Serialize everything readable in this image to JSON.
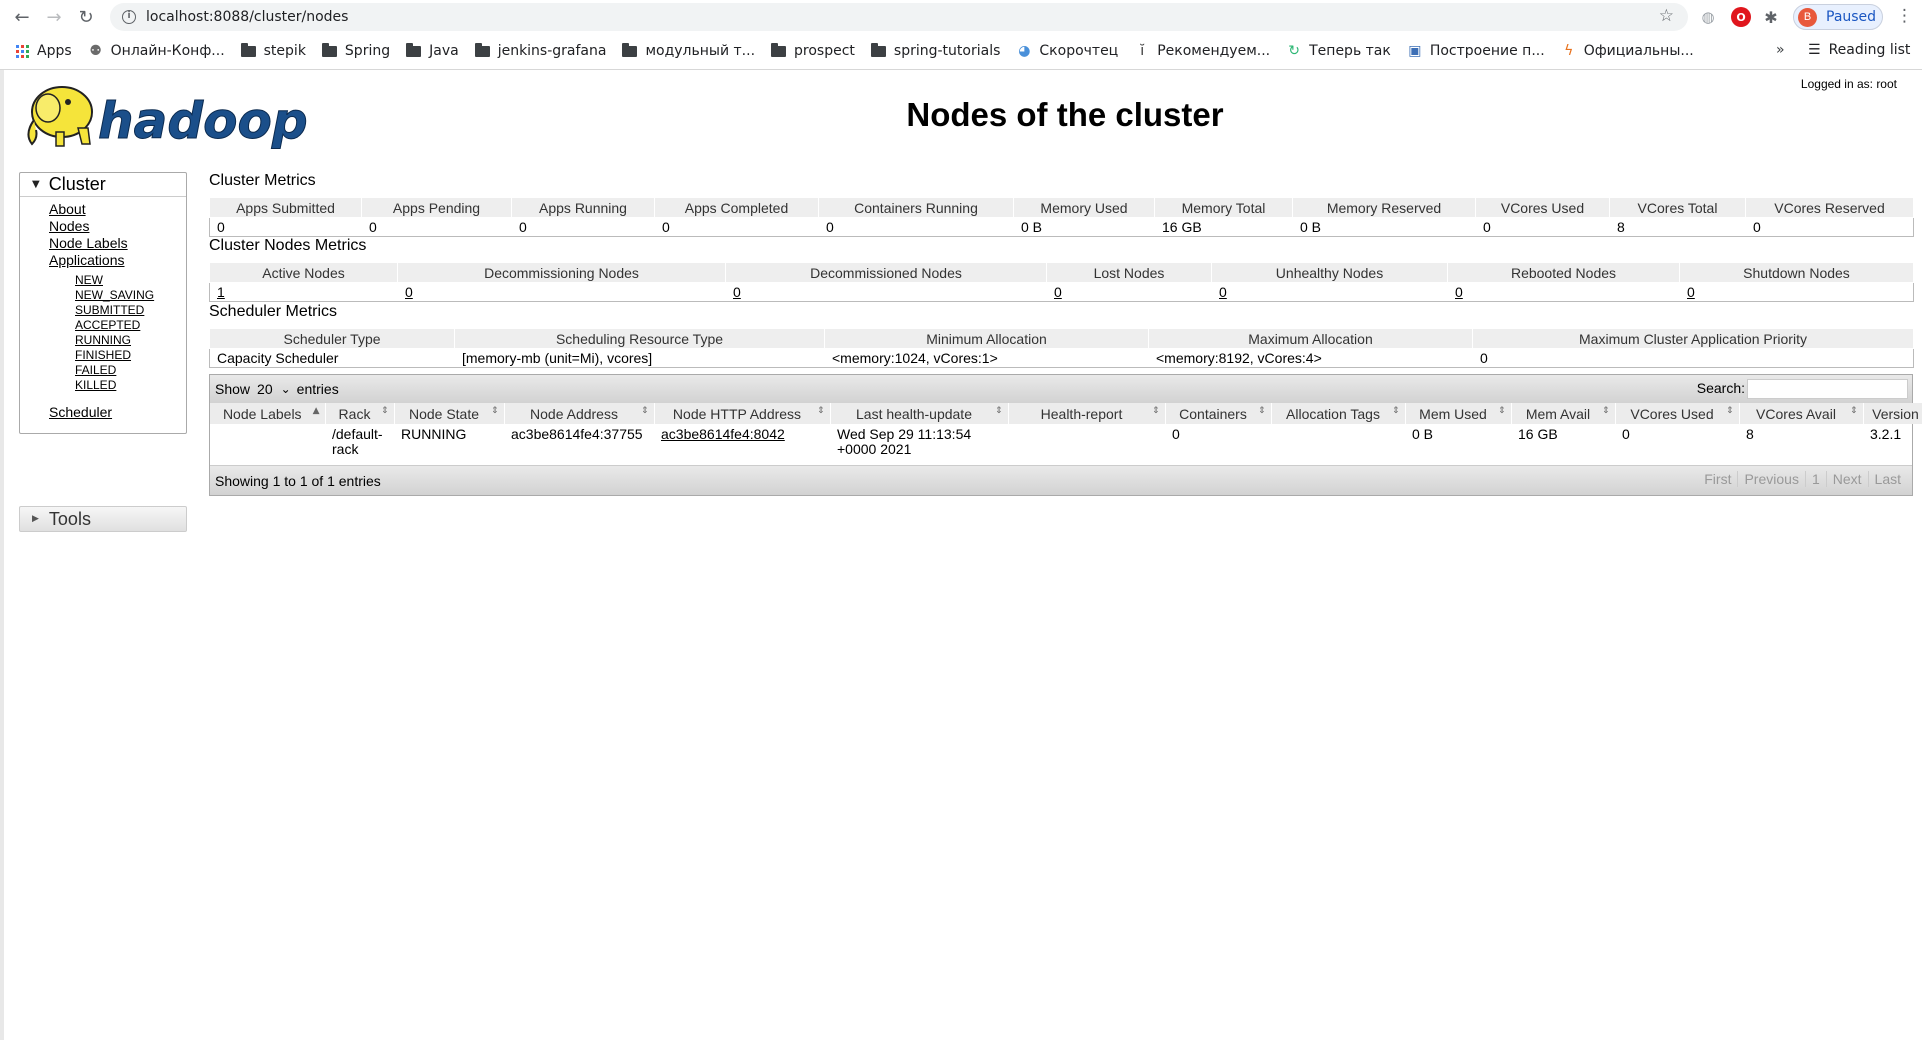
{
  "browser": {
    "url": "localhost:8088/cluster/nodes",
    "profile": {
      "initial": "B",
      "status": "Paused"
    },
    "bookmarks": [
      {
        "label": "Apps",
        "icon": "apps-grid-icon"
      },
      {
        "label": "Онлайн-Конф...",
        "icon": "webinar-icon"
      },
      {
        "label": "stepik",
        "icon": "folder-icon"
      },
      {
        "label": "Spring",
        "icon": "folder-icon"
      },
      {
        "label": "Java",
        "icon": "folder-icon"
      },
      {
        "label": "jenkins-grafana",
        "icon": "folder-icon"
      },
      {
        "label": "модульный т...",
        "icon": "folder-icon"
      },
      {
        "label": "prospect",
        "icon": "folder-icon"
      },
      {
        "label": "spring-tutorials",
        "icon": "folder-icon"
      },
      {
        "label": "Скорочтец",
        "icon": "site-icon"
      },
      {
        "label": "Рекомендуем...",
        "icon": "site-icon"
      },
      {
        "label": "Теперь так",
        "icon": "site-icon"
      },
      {
        "label": "Построение п...",
        "icon": "site-icon"
      },
      {
        "label": "Официальны...",
        "icon": "site-icon"
      }
    ],
    "more_label": "»",
    "reading_list": "Reading list"
  },
  "page": {
    "title": "Nodes of the cluster",
    "logged_in": "Logged in as: root",
    "logo_text": "hadoop"
  },
  "sidebar": {
    "cluster_label": "Cluster",
    "links": [
      "About",
      "Nodes",
      "Node Labels",
      "Applications"
    ],
    "app_states": [
      "NEW",
      "NEW_SAVING",
      "SUBMITTED",
      "ACCEPTED",
      "RUNNING",
      "FINISHED",
      "FAILED",
      "KILLED"
    ],
    "scheduler": "Scheduler",
    "tools_label": "Tools"
  },
  "cluster_metrics": {
    "title": "Cluster Metrics",
    "headers": [
      "Apps Submitted",
      "Apps Pending",
      "Apps Running",
      "Apps Completed",
      "Containers Running",
      "Memory Used",
      "Memory Total",
      "Memory Reserved",
      "VCores Used",
      "VCores Total",
      "VCores Reserved"
    ],
    "values": [
      "0",
      "0",
      "0",
      "0",
      "0",
      "0 B",
      "16 GB",
      "0 B",
      "0",
      "8",
      "0"
    ]
  },
  "node_metrics": {
    "title": "Cluster Nodes Metrics",
    "headers": [
      "Active Nodes",
      "Decommissioning Nodes",
      "Decommissioned Nodes",
      "Lost Nodes",
      "Unhealthy Nodes",
      "Rebooted Nodes",
      "Shutdown Nodes"
    ],
    "values": [
      "1",
      "0",
      "0",
      "0",
      "0",
      "0",
      "0"
    ]
  },
  "scheduler_metrics": {
    "title": "Scheduler Metrics",
    "headers": [
      "Scheduler Type",
      "Scheduling Resource Type",
      "Minimum Allocation",
      "Maximum Allocation",
      "Maximum Cluster Application Priority"
    ],
    "values": [
      "Capacity Scheduler",
      "[memory-mb (unit=Mi), vcores]",
      "<memory:1024, vCores:1>",
      "<memory:8192, vCores:4>",
      "0"
    ]
  },
  "nodes_table": {
    "show_label": "Show",
    "page_size": "20",
    "entries_label": "entries",
    "search_label": "Search:",
    "search_value": "",
    "headers": [
      "Node Labels",
      "Rack",
      "Node State",
      "Node Address",
      "Node HTTP Address",
      "Last health-update",
      "Health-report",
      "Containers",
      "Allocation Tags",
      "Mem Used",
      "Mem Avail",
      "VCores Used",
      "VCores Avail",
      "Version"
    ],
    "rows": [
      [
        "",
        "/default-rack",
        "RUNNING",
        "ac3be8614fe4:37755",
        "ac3be8614fe4:8042",
        "Wed Sep 29 11:13:54 +0000 2021",
        "",
        "0",
        "",
        "0 B",
        "16 GB",
        "0",
        "8",
        "3.2.1"
      ]
    ],
    "info": "Showing 1 to 1 of 1 entries",
    "pager": [
      "First",
      "Previous",
      "1",
      "Next",
      "Last"
    ]
  }
}
